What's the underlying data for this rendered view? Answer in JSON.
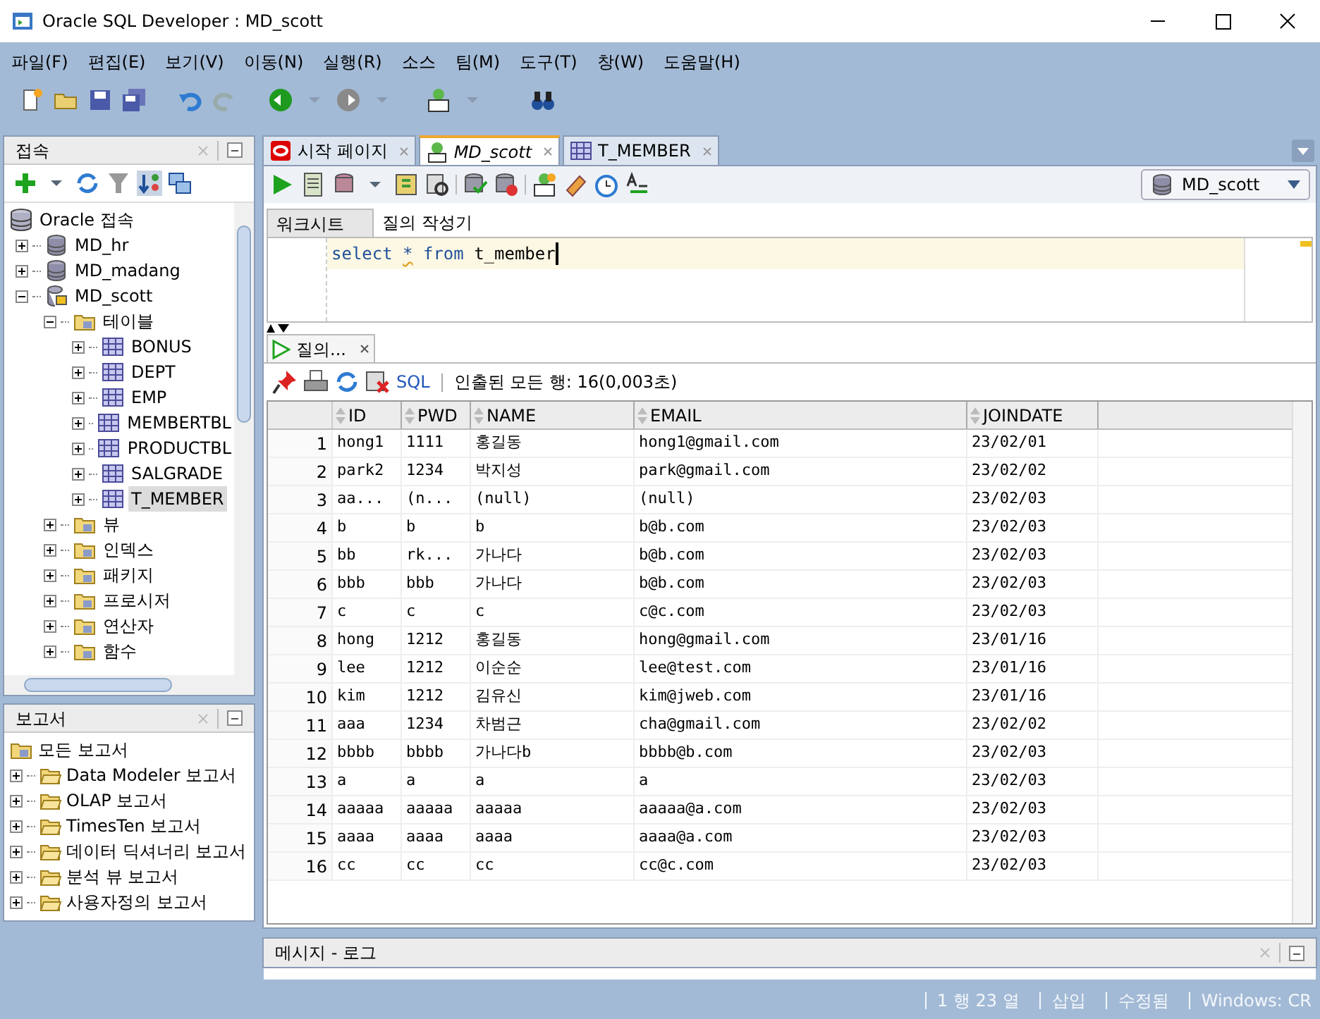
{
  "window": {
    "title": "Oracle SQL Developer : MD_scott"
  },
  "menu": [
    "파일(F)",
    "편집(E)",
    "보기(V)",
    "이동(N)",
    "실행(R)",
    "소스",
    "팀(M)",
    "도구(T)",
    "창(W)",
    "도움말(H)"
  ],
  "connections": {
    "title": "접속",
    "tree": [
      {
        "label": "Oracle 접속",
        "kind": "root",
        "children": [
          {
            "label": "MD_hr",
            "kind": "connection",
            "expanded": false,
            "selected": false
          },
          {
            "label": "MD_madang",
            "kind": "connection",
            "expanded": false,
            "selected": false
          },
          {
            "label": "MD_scott",
            "kind": "active-connection",
            "expanded": true,
            "selected": false,
            "children": [
              {
                "label": "테이블",
                "kind": "folder",
                "expanded": true,
                "selected": false,
                "children": [
                  {
                    "label": "BONUS",
                    "kind": "table",
                    "expanded": false,
                    "selected": false
                  },
                  {
                    "label": "DEPT",
                    "kind": "table",
                    "expanded": false,
                    "selected": false
                  },
                  {
                    "label": "EMP",
                    "kind": "table",
                    "expanded": false,
                    "selected": false
                  },
                  {
                    "label": "MEMBERTBL",
                    "kind": "table",
                    "expanded": false,
                    "selected": false
                  },
                  {
                    "label": "PRODUCTBL",
                    "kind": "table",
                    "expanded": false,
                    "selected": false
                  },
                  {
                    "label": "SALGRADE",
                    "kind": "table",
                    "expanded": false,
                    "selected": false
                  },
                  {
                    "label": "T_MEMBER",
                    "kind": "table",
                    "expanded": false,
                    "selected": true
                  }
                ]
              },
              {
                "label": "뷰",
                "kind": "folder",
                "expanded": false,
                "selected": false
              },
              {
                "label": "인덱스",
                "kind": "folder",
                "expanded": false,
                "selected": false
              },
              {
                "label": "패키지",
                "kind": "folder",
                "expanded": false,
                "selected": false
              },
              {
                "label": "프로시저",
                "kind": "folder",
                "expanded": false,
                "selected": false
              },
              {
                "label": "연산자",
                "kind": "folder",
                "expanded": false,
                "selected": false
              },
              {
                "label": "함수",
                "kind": "folder",
                "expanded": false,
                "selected": false
              }
            ]
          }
        ]
      }
    ]
  },
  "reports": {
    "title": "보고서",
    "root": "모든 보고서",
    "items": [
      "Data Modeler 보고서",
      "OLAP 보고서",
      "TimesTen 보고서",
      "데이터 딕셔너리 보고서",
      "분석 뷰 보고서",
      "사용자정의 보고서"
    ]
  },
  "editor_tabs": [
    {
      "label": "시작 페이지",
      "kind": "start",
      "selected": false
    },
    {
      "label": "MD_scott",
      "kind": "sql",
      "selected": true
    },
    {
      "label": "T_MEMBER",
      "kind": "table",
      "selected": false
    }
  ],
  "connection_selector": "MD_scott",
  "worksheet_tabs": [
    {
      "label": "워크시트",
      "selected": true
    },
    {
      "label": "질의 작성기",
      "selected": false
    }
  ],
  "code": [
    {
      "text": "select",
      "kind": "keyword"
    },
    {
      "text": "*",
      "kind": "warning"
    },
    {
      "text": "from",
      "kind": "keyword"
    },
    {
      "text": "t_member",
      "kind": "plain"
    }
  ],
  "results": {
    "tab": "질의...",
    "sql_link": "SQL",
    "status": "인출된 모든 행: 16(0,003초)",
    "columns": [
      "ID",
      "PWD",
      "NAME",
      "EMAIL",
      "JOINDATE"
    ],
    "rows": [
      {
        "num": "1",
        "cells": [
          "hong1",
          "1111",
          "홍길동",
          "hong1@gmail.com",
          "23/02/01"
        ]
      },
      {
        "num": "2",
        "cells": [
          "park2",
          "1234",
          "박지성",
          "park@gmail.com",
          "23/02/02"
        ]
      },
      {
        "num": "3",
        "cells": [
          "aa...",
          "(n...",
          "(null)",
          "(null)",
          "23/02/03"
        ]
      },
      {
        "num": "4",
        "cells": [
          "b",
          "b",
          "b",
          "b@b.com",
          "23/02/03"
        ]
      },
      {
        "num": "5",
        "cells": [
          "bb",
          "rk...",
          "가나다",
          "b@b.com",
          "23/02/03"
        ]
      },
      {
        "num": "6",
        "cells": [
          "bbb",
          "bbb",
          "가나다",
          "b@b.com",
          "23/02/03"
        ]
      },
      {
        "num": "7",
        "cells": [
          "c",
          "c",
          "c",
          "c@c.com",
          "23/02/03"
        ]
      },
      {
        "num": "8",
        "cells": [
          "hong",
          "1212",
          "홍길동",
          "hong@gmail.com",
          "23/01/16"
        ]
      },
      {
        "num": "9",
        "cells": [
          "lee",
          "1212",
          "이순순",
          "lee@test.com",
          "23/01/16"
        ]
      },
      {
        "num": "10",
        "cells": [
          "kim",
          "1212",
          "김유신",
          "kim@jweb.com",
          "23/01/16"
        ]
      },
      {
        "num": "11",
        "cells": [
          "aaa",
          "1234",
          "차범근",
          "cha@gmail.com",
          "23/02/02"
        ]
      },
      {
        "num": "12",
        "cells": [
          "bbbb",
          "bbbb",
          "가나다b",
          "bbbb@b.com",
          "23/02/03"
        ]
      },
      {
        "num": "13",
        "cells": [
          "a",
          "a",
          "a",
          "a",
          "23/02/03"
        ]
      },
      {
        "num": "14",
        "cells": [
          "aaaaa",
          "aaaaa",
          "aaaaa",
          "aaaaa@a.com",
          "23/02/03"
        ]
      },
      {
        "num": "15",
        "cells": [
          "aaaa",
          "aaaa",
          "aaaa",
          "aaaa@a.com",
          "23/02/03"
        ]
      },
      {
        "num": "16",
        "cells": [
          "cc",
          "cc",
          "cc",
          "cc@c.com",
          "23/02/03"
        ]
      }
    ]
  },
  "message_panel": {
    "title": "메시지 - 로그"
  },
  "status_bar": [
    "1 행 23 열",
    "삽입",
    "수정됨",
    "Windows: CR"
  ]
}
